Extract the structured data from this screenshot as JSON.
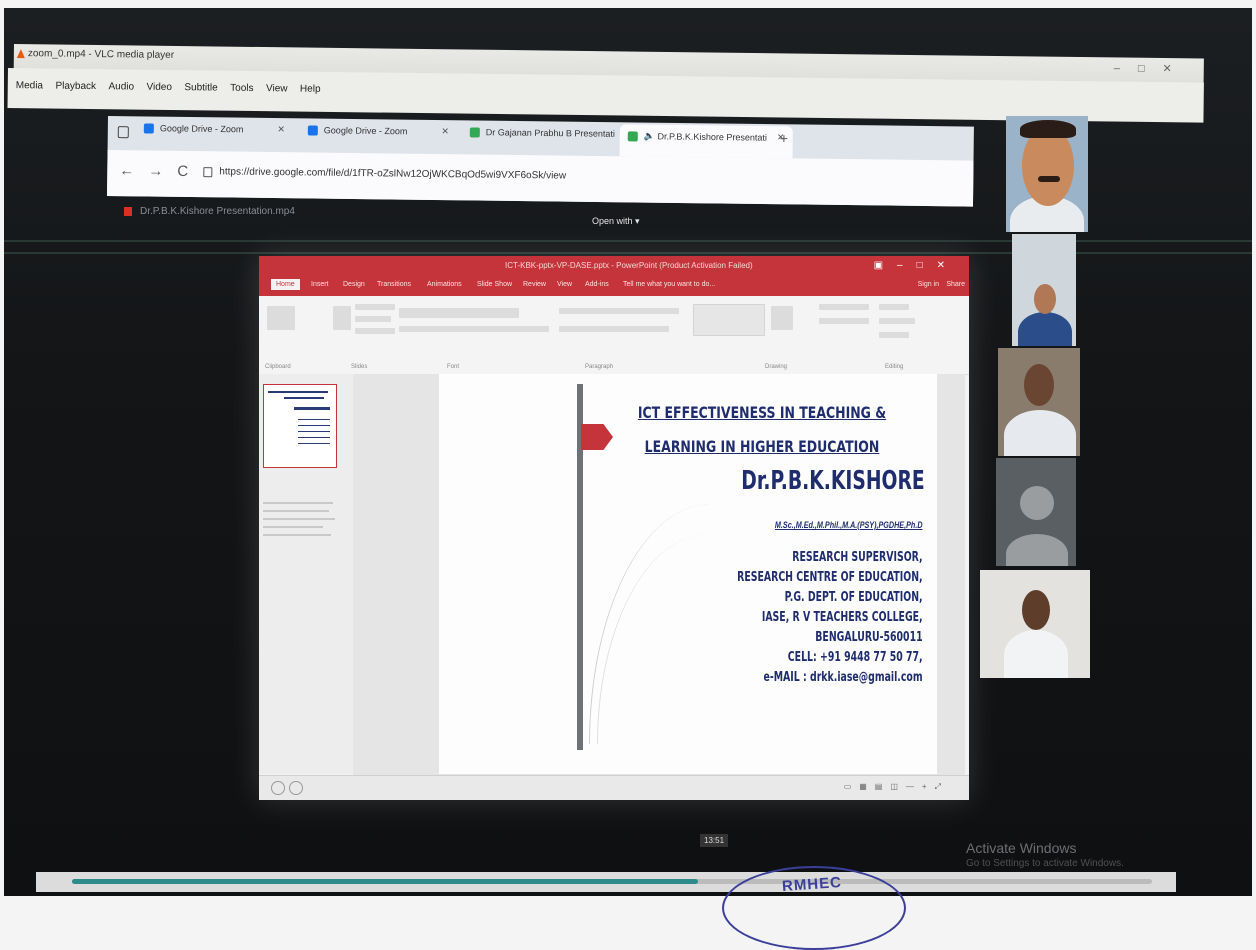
{
  "vlc": {
    "title": "zoom_0.mp4 - VLC media player",
    "menu": [
      "Media",
      "Playback",
      "Audio",
      "Video",
      "Subtitle",
      "Tools",
      "View",
      "Help"
    ],
    "elapsed": "",
    "total": "",
    "progress": 0.58,
    "time_indicator": "13:51"
  },
  "browser": {
    "tabs": [
      {
        "label": "Google Drive - Zoom"
      },
      {
        "label": "Google Drive - Zoom"
      },
      {
        "label": "Dr Gajanan Prabhu B Presentati"
      },
      {
        "label": "Dr.P.B.K.Kishore Presentati"
      }
    ],
    "new_tab": "+",
    "url": "https://drive.google.com/file/d/1fTR-oZslNw12OjWKCBqOd5wi9VXF6oSk/view",
    "file_name": "Dr.P.B.K.Kishore Presentation.mp4",
    "open_with": "Open with"
  },
  "ppt": {
    "doc_title": "ICT-KBK-pptx-VP-DASE.pptx - PowerPoint (Product Activation Failed)",
    "tabs": [
      "Home",
      "Insert",
      "Design",
      "Transitions",
      "Animations",
      "Slide Show",
      "Review",
      "View",
      "Add-ins"
    ],
    "tell_me": "Tell me what you want to do...",
    "sign_in": "Sign in",
    "share": "Share",
    "groups": [
      "Clipboard",
      "Slides",
      "Font",
      "Paragraph",
      "Drawing",
      "Editing"
    ]
  },
  "slide": {
    "title": "ICT EFFECTIVENESS IN TEACHING & LEARNING IN HIGHER EDUCATION",
    "name": "Dr.P.B.K.KISHORE",
    "degrees": "M.Sc.,M.Ed.,M.Phil.,M.A.(PSY),PGDHE,Ph.D",
    "address_lines": [
      "RESEARCH SUPERVISOR,",
      "RESEARCH CENTRE OF EDUCATION,",
      "P.G. DEPT. OF EDUCATION,",
      "IASE, R V TEACHERS COLLEGE,",
      "BENGALURU-560011",
      "CELL: +91 9448 77 50 77,",
      "e-MAIL : drkk.iase@gmail.com"
    ]
  },
  "watermark": {
    "title": "Activate Windows",
    "subtitle": "Go to Settings to activate Windows."
  },
  "stamp_text": "RMHEC",
  "colors": {
    "accent": "#c4343a",
    "slide_text": "#1f2d6e",
    "vlc_orange": "#e8590c"
  }
}
